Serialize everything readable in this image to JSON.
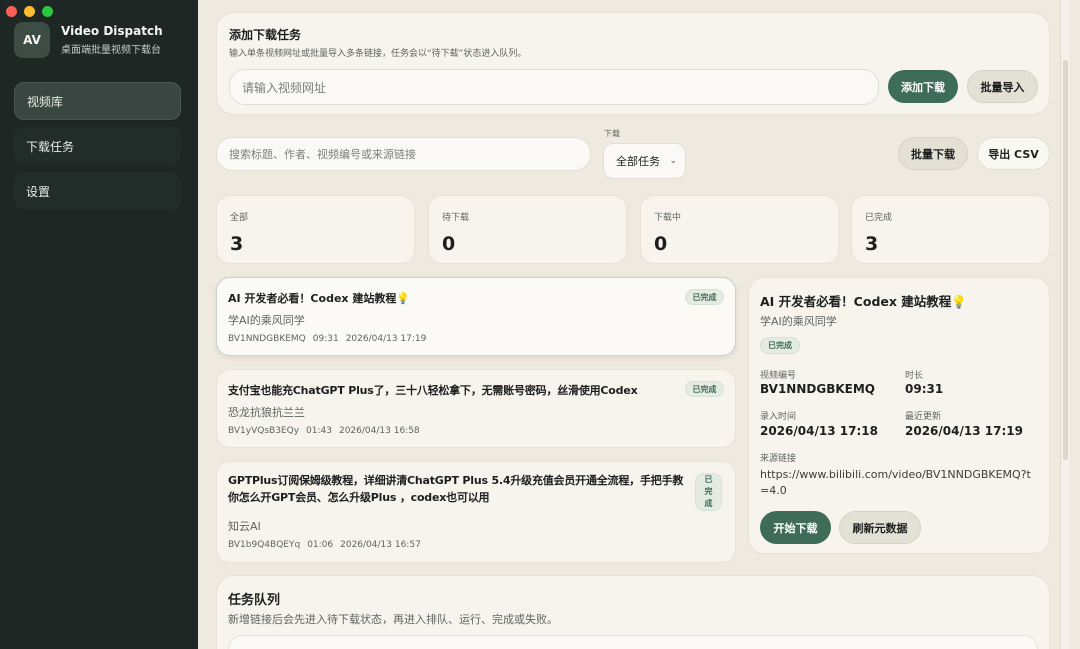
{
  "window": {
    "traffic_colors": [
      "#ff5f57",
      "#febc2e",
      "#28c840"
    ]
  },
  "sidebar": {
    "avatar": "AV",
    "title": "Video Dispatch",
    "subtitle": "桌面端批量视频下载台",
    "items": [
      {
        "label": "视频库",
        "active": true
      },
      {
        "label": "下载任务",
        "active": false
      },
      {
        "label": "设置",
        "active": false
      }
    ]
  },
  "add_task": {
    "title": "添加下载任务",
    "description": "输入单条视频网址或批量导入多条链接，任务会以“待下载”状态进入队列。",
    "url_placeholder": "请输入视频网址",
    "add_button": "添加下载",
    "import_button": "批量导入"
  },
  "filters": {
    "search_placeholder": "搜索标题、作者、视频编号或来源链接",
    "download_label": "下载",
    "download_select": "全部任务",
    "batch_download_button": "批量下载",
    "export_button": "导出 CSV"
  },
  "stats": [
    {
      "label": "全部",
      "value": "3"
    },
    {
      "label": "待下载",
      "value": "0"
    },
    {
      "label": "下载中",
      "value": "0"
    },
    {
      "label": "已完成",
      "value": "3"
    }
  ],
  "videos": [
    {
      "title": "AI 开发者必看！Codex 建站教程💡",
      "author": "学AI的乘风同学",
      "id": "BV1NNDGBKEMQ",
      "duration": "09:31",
      "date": "2026/04/13 17:19",
      "status": "已完成"
    },
    {
      "title": "支付宝也能充ChatGPT Plus了，三十八轻松拿下，无需账号密码，丝滑使用Codex",
      "author": "恐龙抗狼抗兰兰",
      "id": "BV1yVQsB3EQy",
      "duration": "01:43",
      "date": "2026/04/13 16:58",
      "status": "已完成"
    },
    {
      "title": "GPTPlus订阅保姆级教程，详细讲清ChatGPT Plus 5.4升级充值会员开通全流程，手把手教你怎么开GPT会员、怎么升级Plus ，codex也可以用",
      "author": "知云AI",
      "id": "BV1b9Q4BQEYq",
      "duration": "01:06",
      "date": "2026/04/13 16:57",
      "status": "已完成"
    }
  ],
  "detail": {
    "title": "AI 开发者必看！Codex 建站教程💡",
    "author": "学AI的乘风同学",
    "status": "已完成",
    "id_label": "视频编号",
    "id_value": "BV1NNDGBKEMQ",
    "duration_label": "时长",
    "duration_value": "09:31",
    "created_label": "录入时间",
    "created_value": "2026/04/13 17:18",
    "updated_label": "最近更新",
    "updated_value": "2026/04/13 17:19",
    "source_label": "来源链接",
    "source_value": "https://www.bilibili.com/video/BV1NNDGBKEMQ?t=4.0",
    "start_button": "开始下载",
    "refresh_button": "刷新元数据"
  },
  "queue": {
    "title": "任务队列",
    "description": "新增链接后会先进入待下载状态，再进入排队、运行、完成或失败。"
  }
}
